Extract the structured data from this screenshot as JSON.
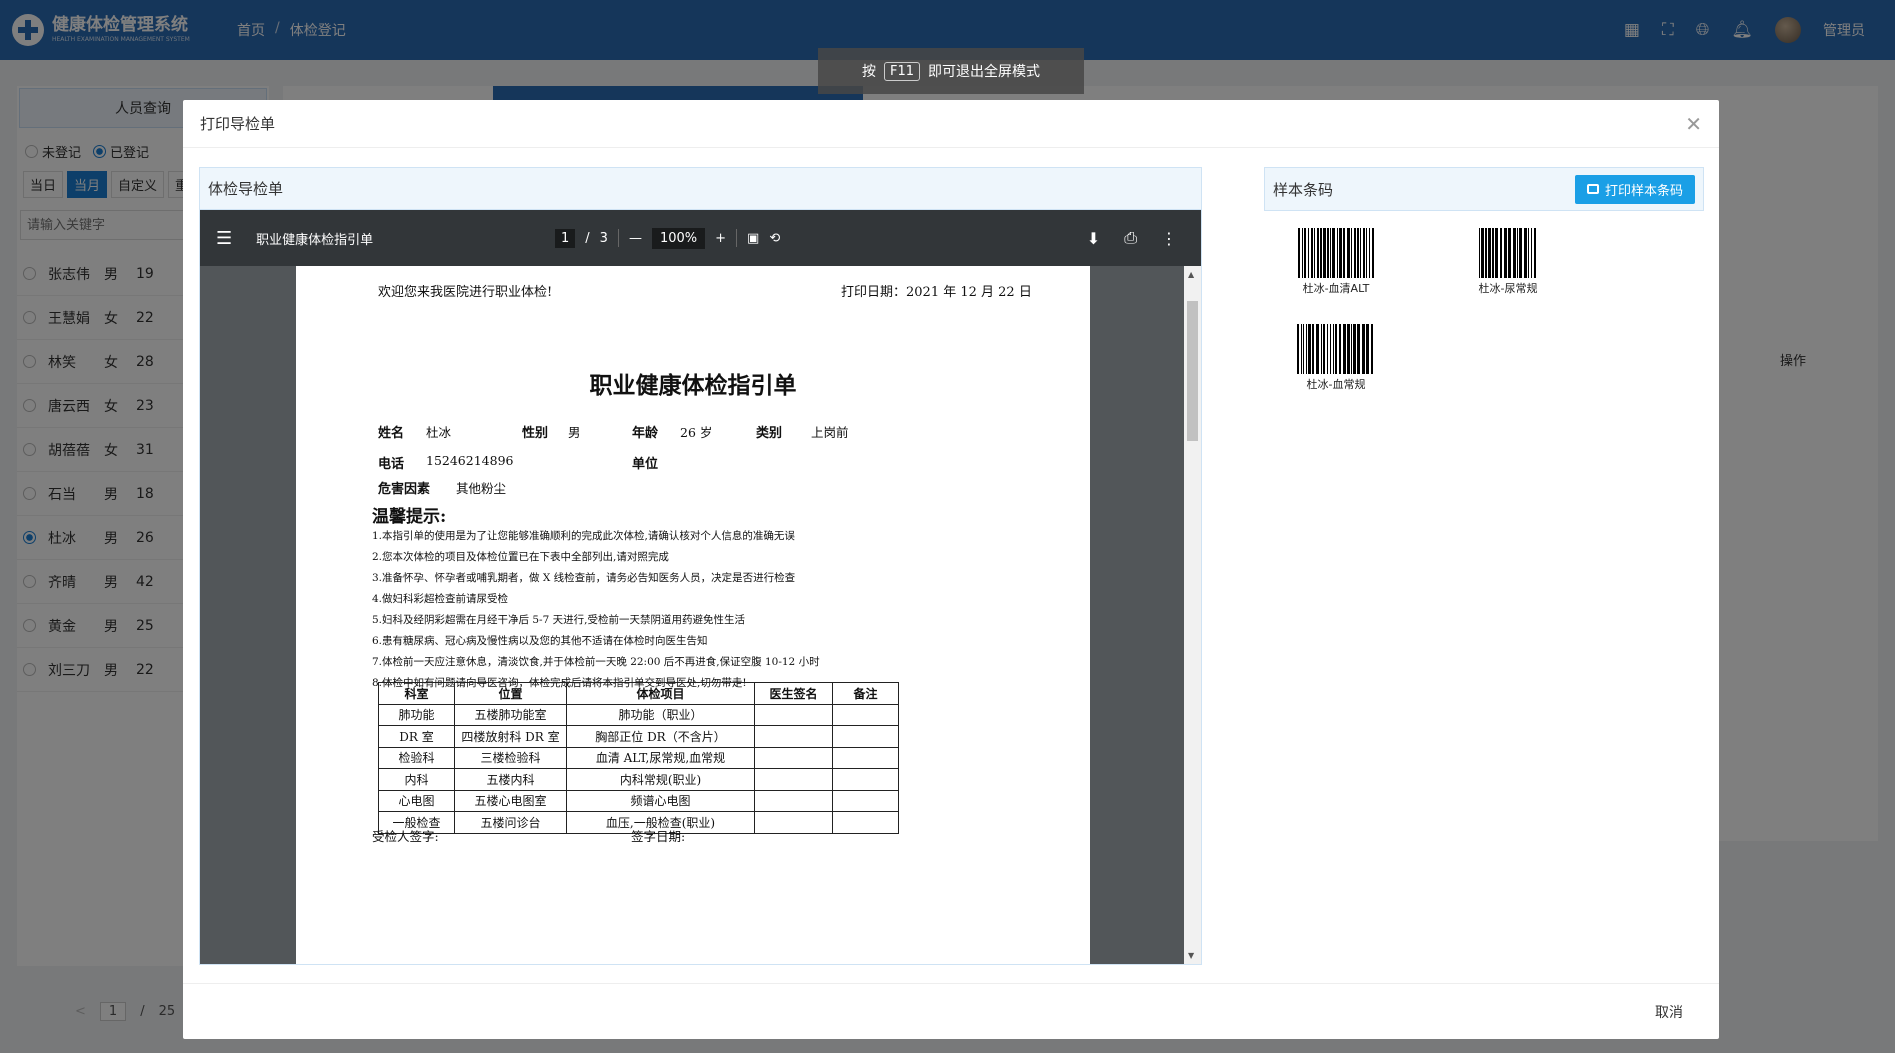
{
  "app": {
    "title": "健康体检管理系统",
    "subtitle": "HEALTH EXAMINATION MANAGEMENT SYSTEM",
    "breadcrumb": [
      "首页",
      "体检登记"
    ],
    "breadcrumb_sep": "/",
    "user": "管理员",
    "brand_color": "#2b6cb5"
  },
  "fullscreen_hint": {
    "prefix": "按",
    "key": "F11",
    "suffix": "即可退出全屏模式"
  },
  "left_panel": {
    "title": "人员查询",
    "radios": [
      {
        "label": "未登记",
        "checked": false
      },
      {
        "label": "已登记",
        "checked": true
      }
    ],
    "date_buttons": [
      {
        "label": "当日",
        "active": false
      },
      {
        "label": "当月",
        "active": true
      },
      {
        "label": "自定义",
        "active": false
      },
      {
        "label": "重置",
        "active": false
      }
    ],
    "keyword_placeholder": "请输入关键字",
    "persons": [
      {
        "name": "张志伟",
        "sex": "男",
        "age": "19",
        "selected": false
      },
      {
        "name": "王慧娟",
        "sex": "女",
        "age": "22",
        "selected": false
      },
      {
        "name": "林笑",
        "sex": "女",
        "age": "28",
        "selected": false
      },
      {
        "name": "唐云西",
        "sex": "女",
        "age": "23",
        "selected": false
      },
      {
        "name": "胡蓓蓓",
        "sex": "女",
        "age": "31",
        "selected": false
      },
      {
        "name": "石当",
        "sex": "男",
        "age": "18",
        "selected": false
      },
      {
        "name": "杜冰",
        "sex": "男",
        "age": "26",
        "selected": true
      },
      {
        "name": "齐晴",
        "sex": "男",
        "age": "42",
        "selected": false
      },
      {
        "name": "黄金",
        "sex": "男",
        "age": "25",
        "selected": false
      },
      {
        "name": "刘三刀",
        "sex": "男",
        "age": "22",
        "selected": false
      }
    ],
    "pager": {
      "current": "1",
      "sep": "/",
      "total": "25"
    }
  },
  "main": {
    "column_op": "操作"
  },
  "modal": {
    "title": "打印导检单",
    "close_icon": "close-icon",
    "cancel_label": "取消",
    "guide_title": "体检导检单",
    "barcode_title": "样本条码",
    "print_barcode_label": "打印样本条码",
    "barcodes": [
      {
        "label": "杜冰-血清ALT"
      },
      {
        "label": "杜冰-尿常规"
      },
      {
        "label": "杜冰-血常规"
      }
    ]
  },
  "pdf": {
    "title": "职业健康体检指引单",
    "page_current": "1",
    "page_sep": "/",
    "page_total": "3",
    "zoom": "100%"
  },
  "doc": {
    "welcome": "欢迎您来我医院进行职业体检!",
    "print_date": "打印日期：2021 年 12 月 22 日",
    "title": "职业健康体检指引单",
    "fields": {
      "name_label": "姓名",
      "name": "杜冰",
      "sex_label": "性别",
      "sex": "男",
      "age_label": "年龄",
      "age": "26 岁",
      "type_label": "类别",
      "type": "上岗前",
      "phone_label": "电话",
      "phone": "15246214896",
      "company_label": "单位",
      "company": "",
      "hazard_label": "危害因素",
      "hazard": "其他粉尘"
    },
    "tips_title": "温馨提示:",
    "tips": [
      "1.本指引单的使用是为了让您能够准确顺利的完成此次体检,请确认核对个人信息的准确无误",
      "2.您本次体检的项目及体检位置已在下表中全部列出,请对照完成",
      "3.准备怀孕、怀孕者或哺乳期者，做 X 线检查前，请务必告知医务人员，决定是否进行检查",
      "4.做妇科彩超检查前请尿受检",
      "5.妇科及经阴彩超需在月经干净后 5-7 天进行,受检前一天禁阴道用药避免性生活",
      "6.患有糖尿病、冠心病及慢性病以及您的其他不适请在体检时向医生告知",
      "7.体检前一天应注意休息，清淡饮食,并于体检前一天晚 22:00 后不再进食,保证空腹 10-12 小时",
      "8.体检中如有问题请向导医咨询，体检完成后请将本指引单交到导医处,切勿带走!"
    ],
    "table": {
      "headers": [
        "科室",
        "位置",
        "体检项目",
        "医生签名",
        "备注"
      ],
      "rows": [
        [
          "肺功能",
          "五楼肺功能室",
          "肺功能（职业）",
          "",
          ""
        ],
        [
          "DR 室",
          "四楼放射科 DR 室",
          "胸部正位 DR（不含片）",
          "",
          ""
        ],
        [
          "检验科",
          "三楼检验科",
          "血清 ALT,尿常规,血常规",
          "",
          ""
        ],
        [
          "内科",
          "五楼内科",
          "内科常规(职业)",
          "",
          ""
        ],
        [
          "心电图",
          "五楼心电图室",
          "频谱心电图",
          "",
          ""
        ],
        [
          "一般检查",
          "五楼问诊台",
          "血压,一般检查(职业)",
          "",
          ""
        ]
      ]
    },
    "sign_label": "受检人签字:",
    "sign_date_label": "签字日期:"
  }
}
